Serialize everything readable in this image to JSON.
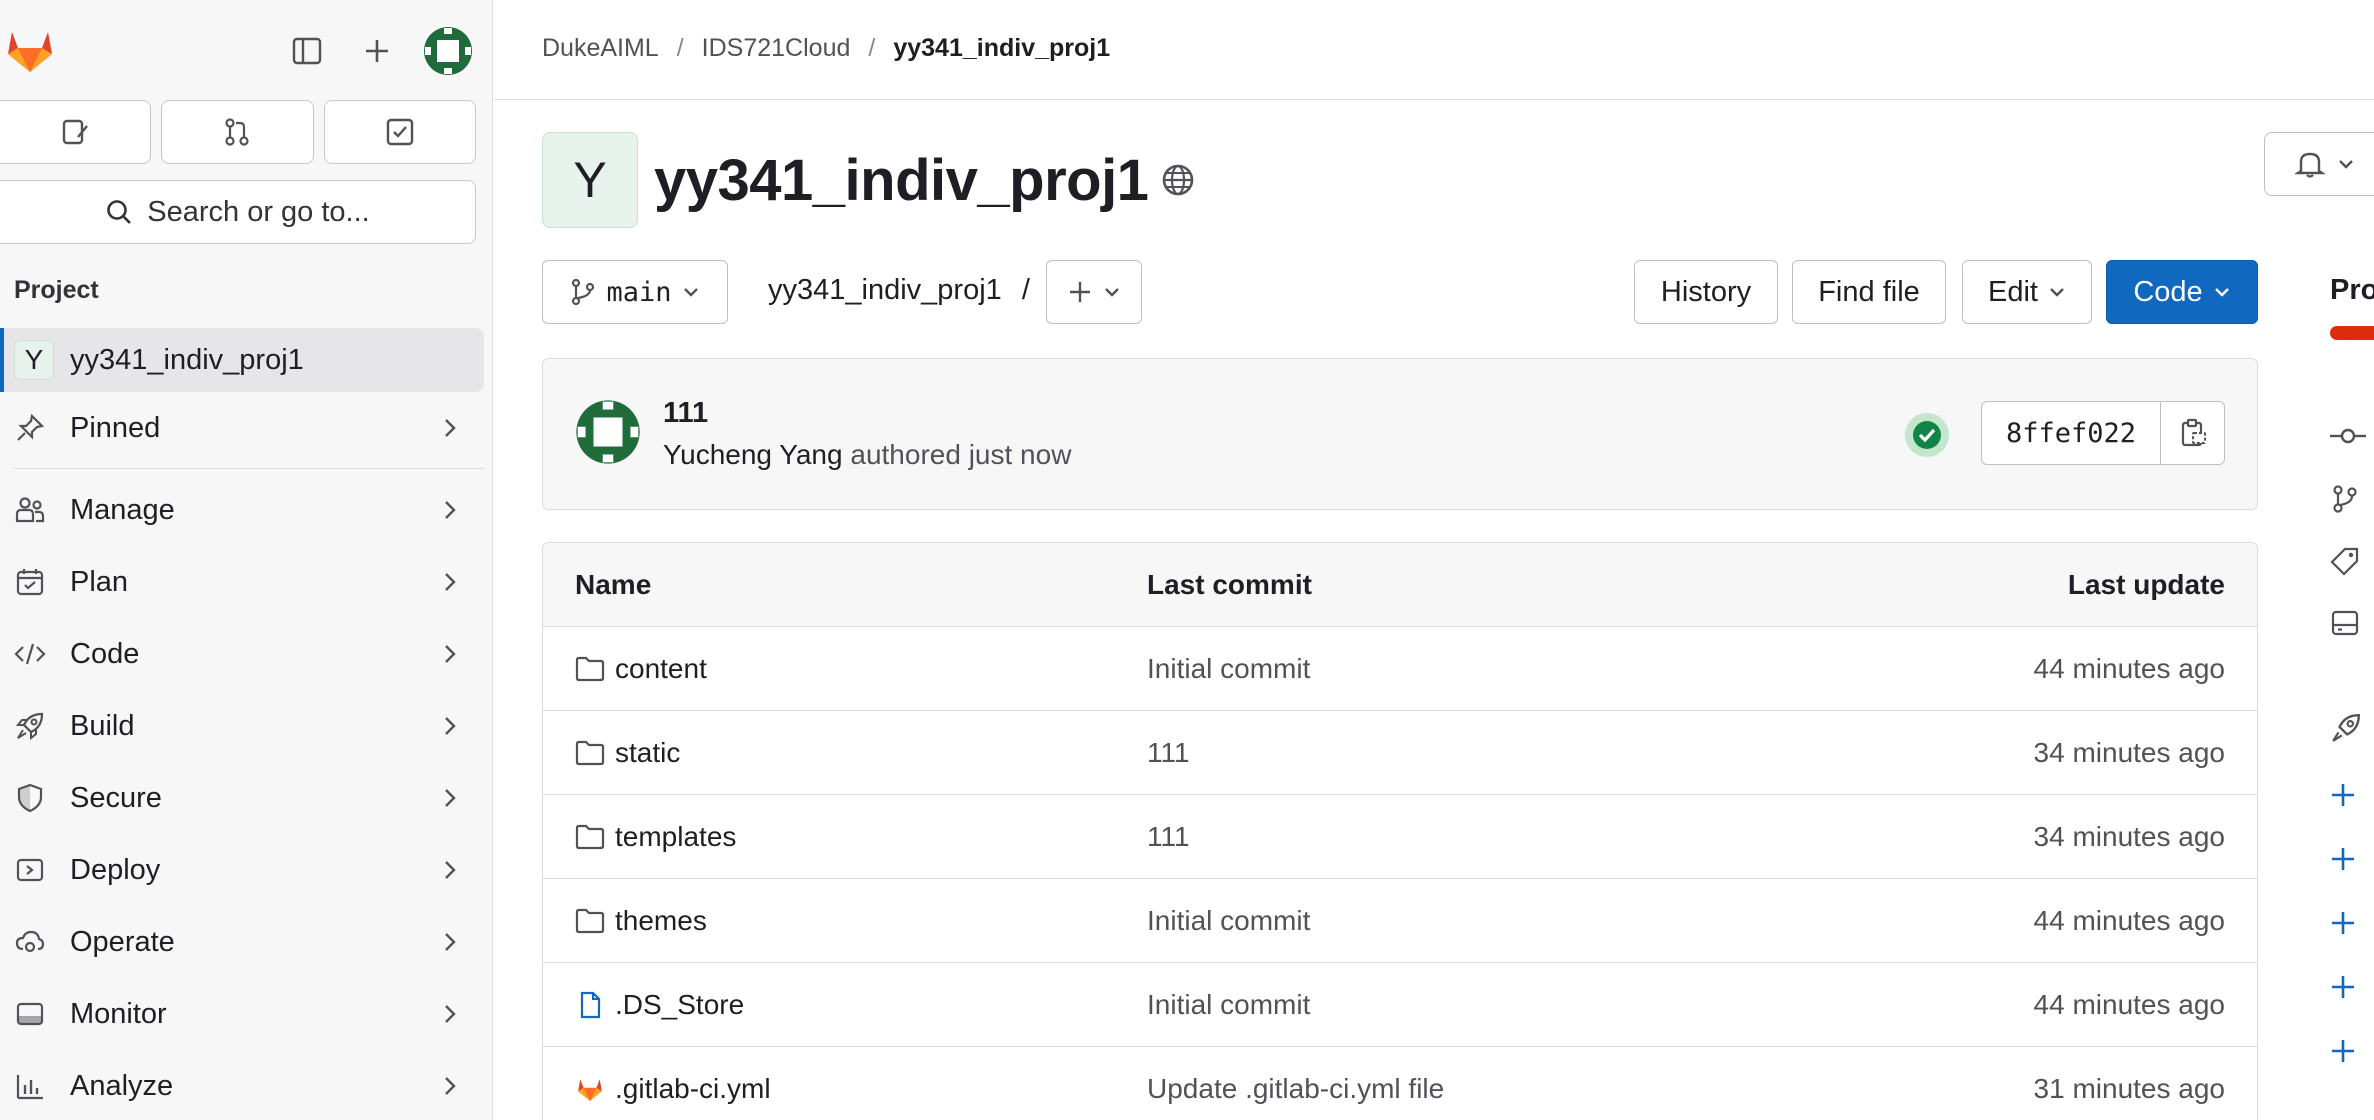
{
  "colors": {
    "accent": "#1068bf",
    "sidebar_bg": "#f7f7f8",
    "success": "#108548",
    "tanuki": "#fc6d26"
  },
  "sidebar": {
    "search_label": "Search or go to...",
    "section_title": "Project",
    "project": {
      "avatar_letter": "Y",
      "label": "yy341_indiv_proj1"
    },
    "items": [
      {
        "label": "Pinned",
        "icon": "pin-icon"
      },
      {
        "label": "Manage",
        "icon": "users-icon"
      },
      {
        "label": "Plan",
        "icon": "calendar-icon"
      },
      {
        "label": "Code",
        "icon": "code-icon"
      },
      {
        "label": "Build",
        "icon": "rocket-icon"
      },
      {
        "label": "Secure",
        "icon": "shield-icon"
      },
      {
        "label": "Deploy",
        "icon": "deploy-icon"
      },
      {
        "label": "Operate",
        "icon": "cloud-gear-icon"
      },
      {
        "label": "Monitor",
        "icon": "monitor-icon"
      },
      {
        "label": "Analyze",
        "icon": "chart-icon"
      }
    ]
  },
  "breadcrumb": {
    "group": "DukeAIML",
    "subgroup": "IDS721Cloud",
    "project": "yy341_indiv_proj1",
    "sep": "/"
  },
  "project": {
    "avatar_letter": "Y",
    "title": "yy341_indiv_proj1"
  },
  "toolbar": {
    "branch": "main",
    "path": "yy341_indiv_proj1",
    "path_sep": "/",
    "history": "History",
    "find_file": "Find file",
    "edit": "Edit",
    "code": "Code"
  },
  "right_panel": {
    "title": "Pro"
  },
  "commit": {
    "message": "111",
    "author": "Yucheng Yang",
    "authored": "authored just now",
    "sha": "8ffef022"
  },
  "file_table": {
    "headers": {
      "name": "Name",
      "last_commit": "Last commit",
      "last_update": "Last update"
    },
    "rows": [
      {
        "name": "content",
        "type": "folder",
        "commit": "Initial commit",
        "updated": "44 minutes ago"
      },
      {
        "name": "static",
        "type": "folder",
        "commit": "111",
        "updated": "34 minutes ago"
      },
      {
        "name": "templates",
        "type": "folder",
        "commit": "111",
        "updated": "34 minutes ago"
      },
      {
        "name": "themes",
        "type": "folder",
        "commit": "Initial commit",
        "updated": "44 minutes ago"
      },
      {
        "name": ".DS_Store",
        "type": "file",
        "commit": "Initial commit",
        "updated": "44 minutes ago"
      },
      {
        "name": ".gitlab-ci.yml",
        "type": "gitlab",
        "commit": "Update .gitlab-ci.yml file",
        "updated": "31 minutes ago"
      }
    ]
  }
}
